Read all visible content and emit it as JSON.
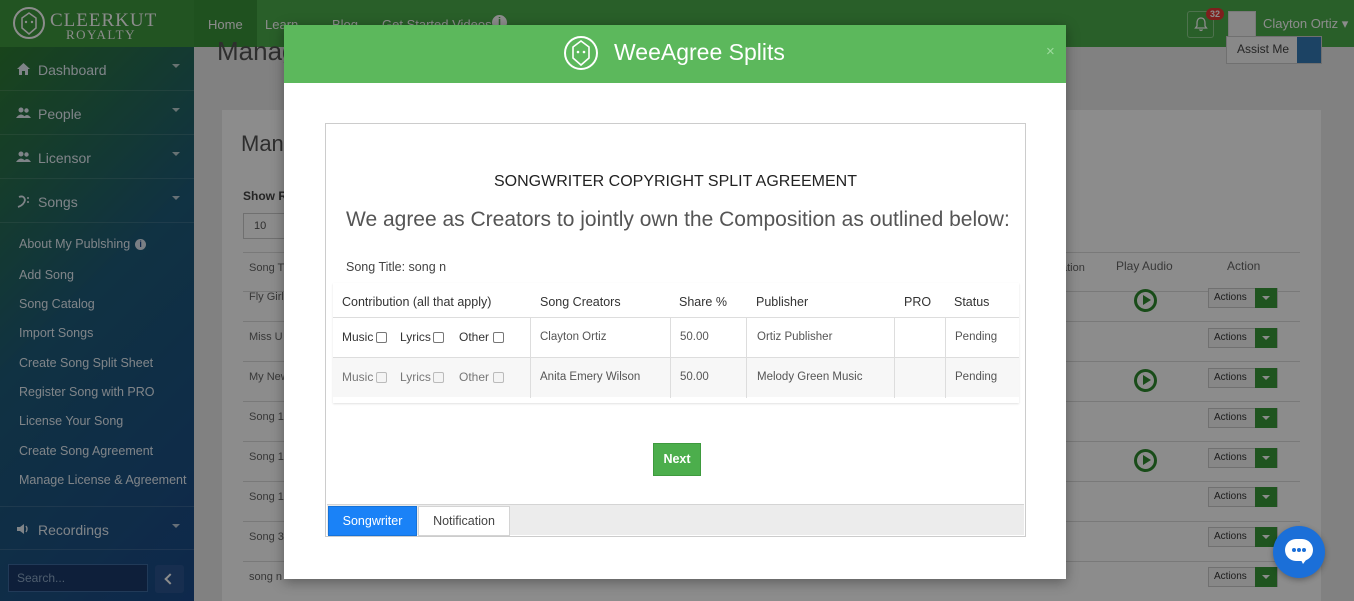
{
  "brand": {
    "line1": "CLEERKUT",
    "line2": "ROYALTY"
  },
  "topnav": {
    "home": "Home",
    "learn": "Learn",
    "blog": "Blog",
    "videos": "Get Started Videos",
    "notification_count": "32",
    "user_name": "Clayton Ortiz"
  },
  "sidebar": {
    "main_items": [
      {
        "label": "Dashboard",
        "icon": "home-icon"
      },
      {
        "label": "People",
        "icon": "users-icon"
      },
      {
        "label": "Licensor",
        "icon": "users-icon"
      },
      {
        "label": "Songs",
        "icon": "music-clef-icon"
      }
    ],
    "sub_items": [
      "About My Publshing",
      "Add Song",
      "Song Catalog",
      "Import Songs",
      "Create Song Split Sheet",
      "Register Song with PRO",
      "License Your Song",
      "Create Song Agreement",
      "Manage License & Agreement"
    ],
    "recordings": "Recordings",
    "search_placeholder": "Search..."
  },
  "background": {
    "page_title": "Manag",
    "panel_title": "Man",
    "show_label": "Show R",
    "show_value": "10",
    "assist_button": "Assist Me",
    "col_song_title": "Song T",
    "col_play_audio": "Play Audio",
    "col_action": "Action",
    "col_partial": "ation",
    "action_label": "Actions",
    "rows": [
      "Fly Girl",
      "Miss U",
      "My New",
      "Song 1",
      "Song 1",
      "Song 1",
      "Song 3",
      "song n"
    ]
  },
  "modal": {
    "title": "WeeAgree Splits",
    "close": "×",
    "agreement_title": "SONGWRITER COPYRIGHT SPLIT AGREEMENT",
    "agreement_subtitle": "We agree as Creators to jointly own the Composition as outlined below:",
    "song_title": "Song Title: song n",
    "table": {
      "headers": {
        "contribution": "Contribution (all that apply)",
        "creators": "Song Creators",
        "share": "Share %",
        "publisher": "Publisher",
        "pro": "PRO",
        "status": "Status"
      },
      "contribution_labels": {
        "music": "Music",
        "lyrics": "Lyrics",
        "other": "Other"
      },
      "rows": [
        {
          "creator": "Clayton Ortiz",
          "share": "50.00",
          "publisher": "Ortiz Publisher",
          "pro": "",
          "status": "Pending"
        },
        {
          "creator": "Anita Emery Wilson",
          "share": "50.00",
          "publisher": "Melody Green Music",
          "pro": "",
          "status": "Pending"
        }
      ]
    },
    "next_button": "Next",
    "tabs": {
      "songwriter": "Songwriter",
      "notification": "Notification"
    }
  }
}
